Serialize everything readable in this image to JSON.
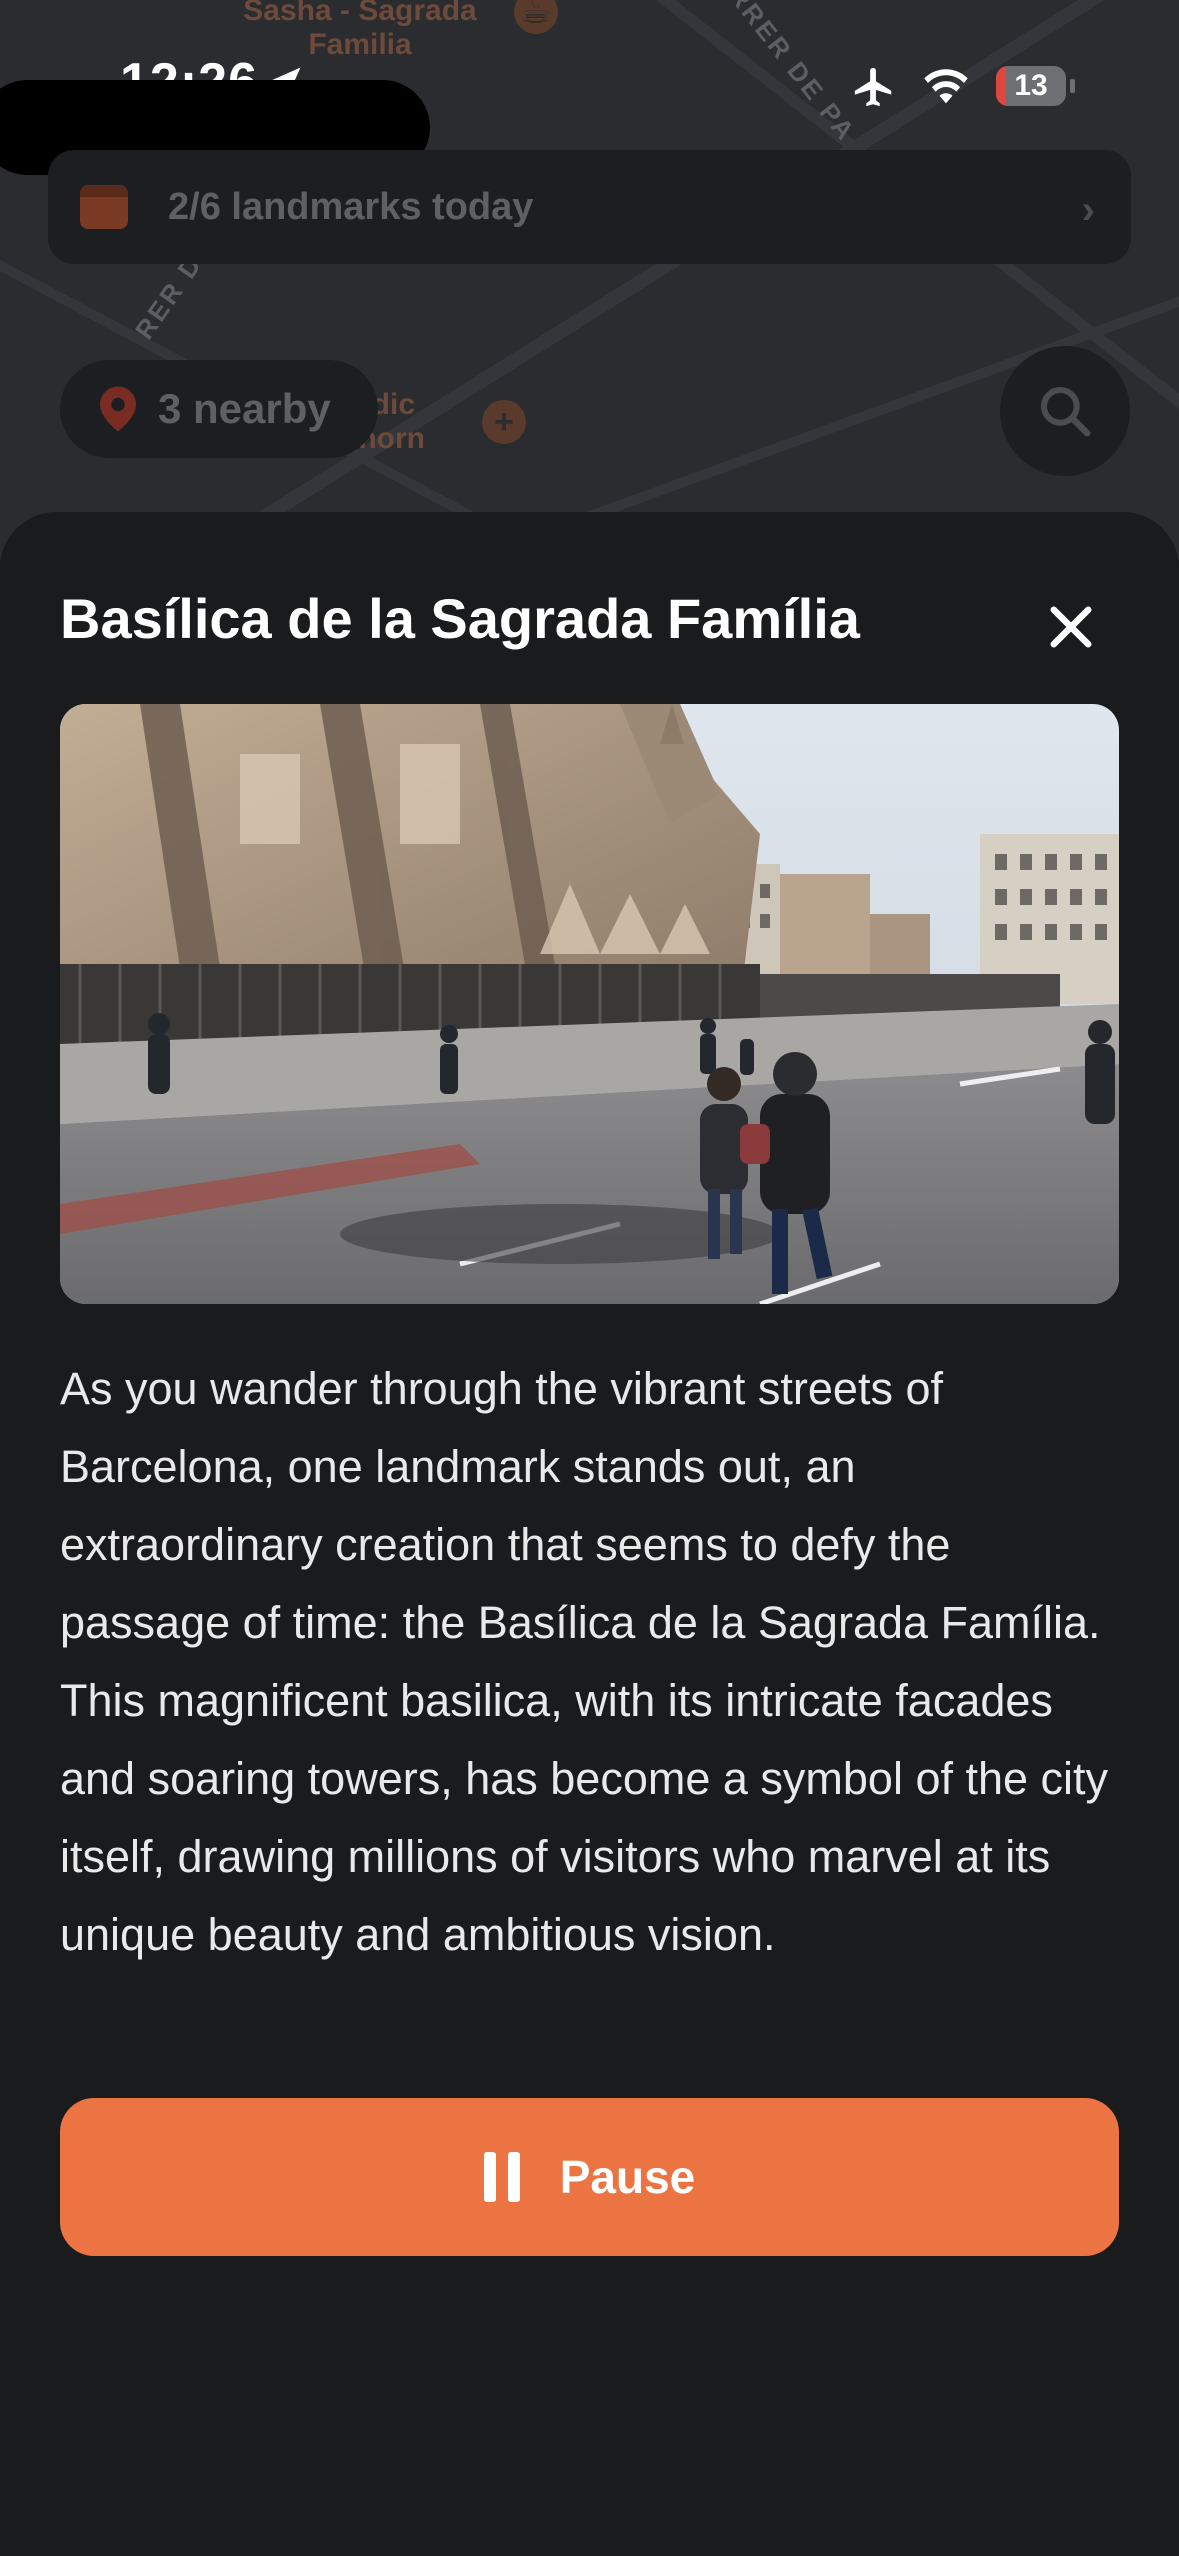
{
  "status_bar": {
    "time": "12:26",
    "battery": "13",
    "icons": [
      "location-arrow-icon",
      "airplane-icon",
      "wifi-icon",
      "battery-icon"
    ]
  },
  "map": {
    "poi_top": "Sasha - Sagrada\nFamilia",
    "poi_medic": "Medic\nerhorn",
    "street_1": "ARRER DE PA",
    "street_2": "RER DE C"
  },
  "landmarks_banner": {
    "label": "2/6 landmarks today"
  },
  "nearby": {
    "label": "3 nearby"
  },
  "sheet": {
    "title": "Basílica de la Sagrada Família",
    "description": "As you wander through the vibrant streets of Barcelona, one landmark stands out, an extraordinary creation that seems to defy the passage of time: the Basílica de la Sagrada Família. This magnificent basilica, with its intricate facades and soaring towers, has become a symbol of the city itself, drawing millions of visitors who marvel at its unique beauty and ambitious vision.",
    "pause_label": "Pause"
  },
  "colors": {
    "accent": "#ec7443",
    "sheet_bg": "#1a1b1d",
    "battery_low": "#e0473c"
  }
}
